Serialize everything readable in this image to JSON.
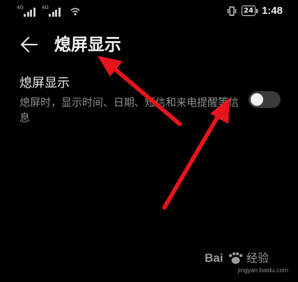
{
  "status_bar": {
    "sim1_tag": "4G",
    "sim2_tag": "4G",
    "battery_level": "24",
    "time": "1:48",
    "icons": [
      "signal-icon",
      "signal-icon",
      "wifi-icon",
      "vibrate-icon",
      "battery-icon"
    ]
  },
  "header": {
    "back_icon": "arrow-left-icon",
    "title": "熄屏显示"
  },
  "setting": {
    "title": "熄屏显示",
    "description": "熄屏时，显示时间、日期、短信和来电提醒等信息",
    "toggle_on": false
  },
  "watermark": {
    "logo_text": "Bai 经验",
    "url": "jingyan.baidu.com"
  },
  "colors": {
    "background": "#000000",
    "annotation_arrow": "#e8141c",
    "toggle_track": "#3b3b3b"
  }
}
